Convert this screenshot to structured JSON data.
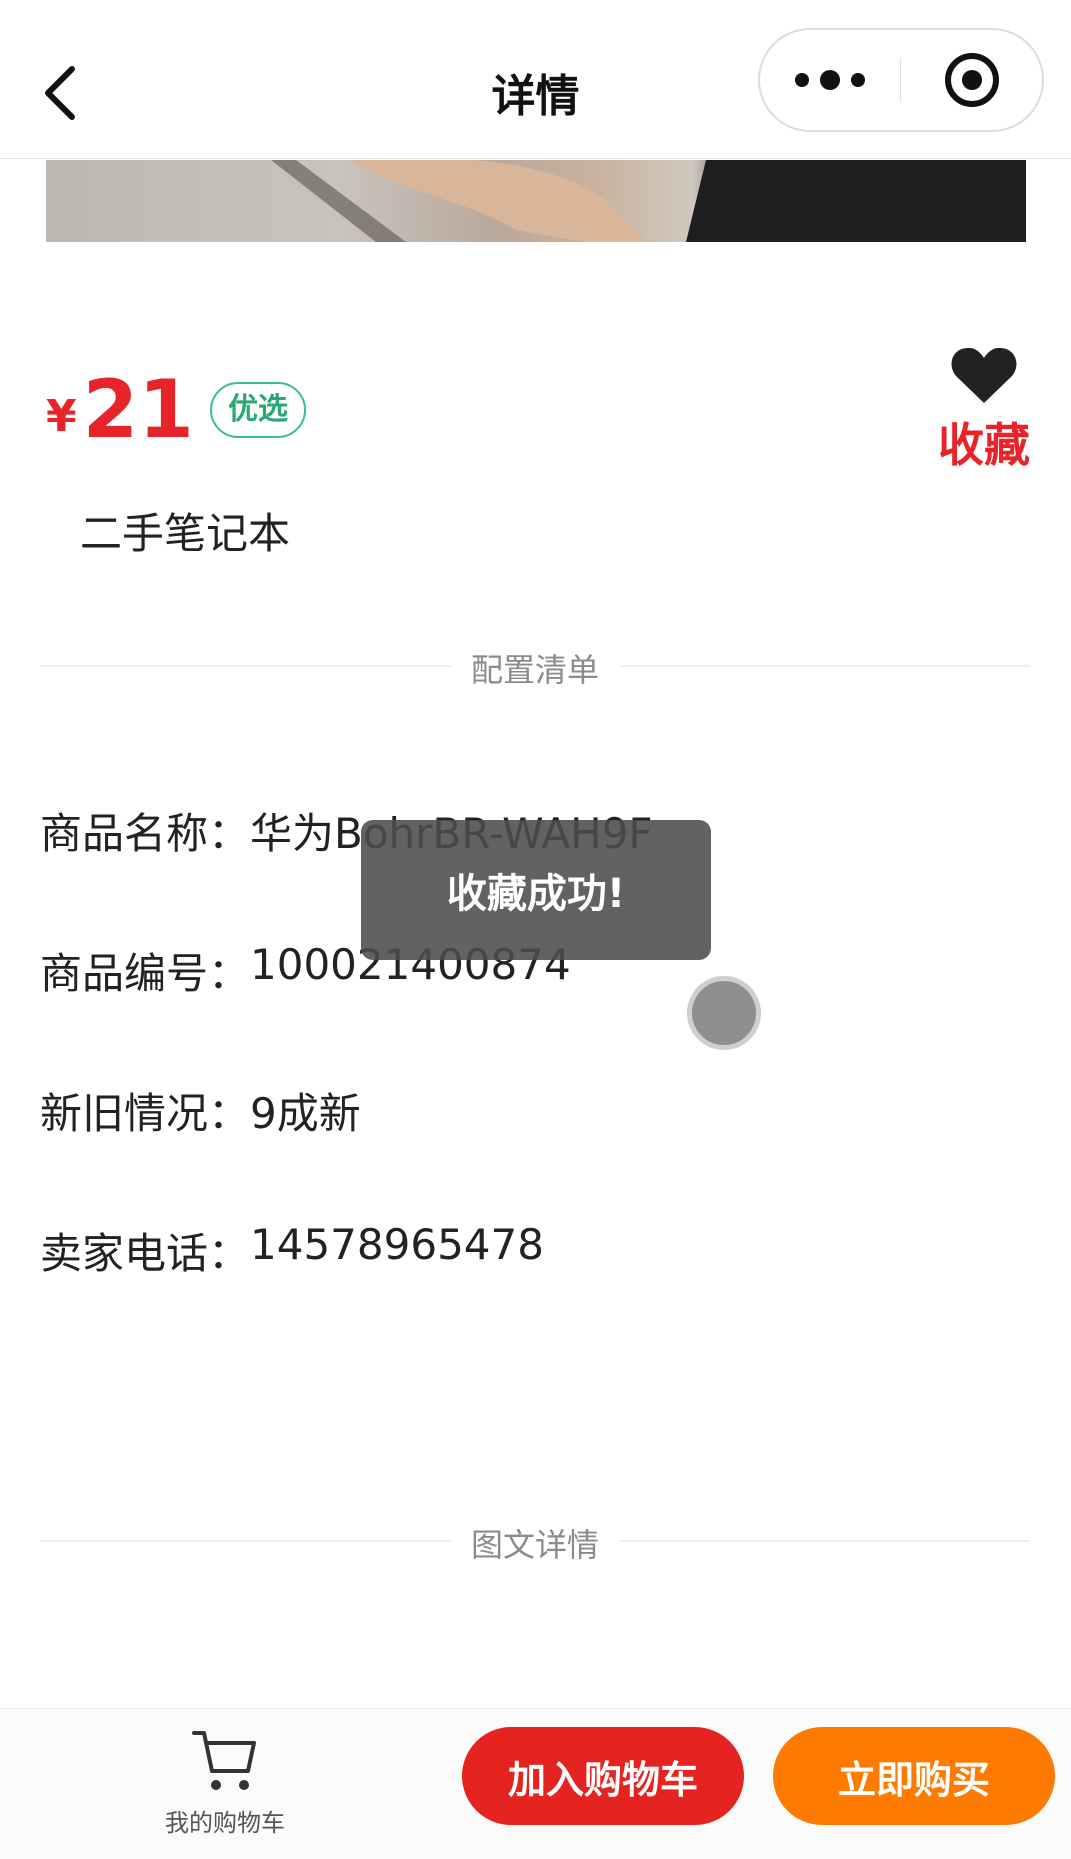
{
  "header": {
    "title": "详情",
    "back_icon": "chevron-left-icon",
    "more_icon": "more-dots-icon",
    "close_icon": "target-close-icon"
  },
  "product": {
    "currency": "¥",
    "price": "21",
    "badge": "优选",
    "name": "二手笔记本",
    "favorite_label": "收藏",
    "favorite_icon": "heart-icon"
  },
  "sections": {
    "config_title": "配置清单",
    "detail_title": "图文详情"
  },
  "specs": [
    {
      "key": "商品名称：",
      "value": "华为BohrBR-WAH9F"
    },
    {
      "key": "商品编号：",
      "value": "100021400874"
    },
    {
      "key": "新旧情况：",
      "value": "9成新"
    },
    {
      "key": "卖家电话：",
      "value": "14578965478"
    }
  ],
  "toast": {
    "message": "收藏成功!"
  },
  "bottom_bar": {
    "cart_label": "我的购物车",
    "cart_icon": "cart-icon",
    "add_to_cart": "加入购物车",
    "buy_now": "立即购买"
  },
  "colors": {
    "price_red": "#e8242b",
    "badge_green": "#2aa874",
    "add_cart_bg": "#e52421",
    "buy_now_bg": "#ff7a00"
  }
}
